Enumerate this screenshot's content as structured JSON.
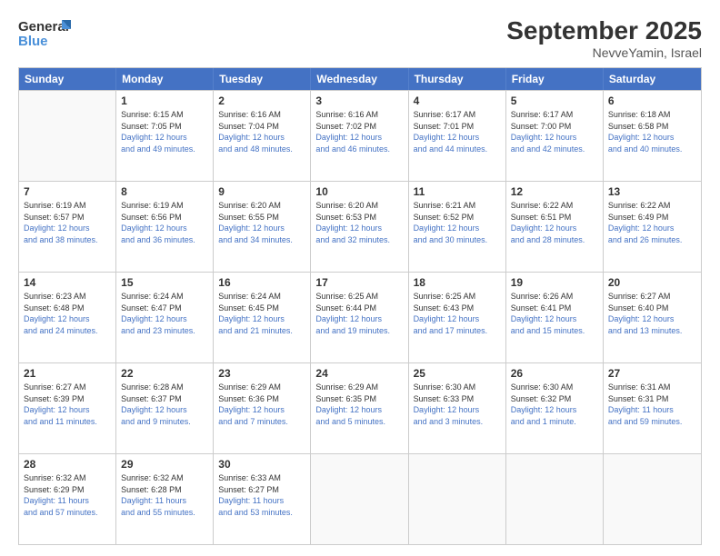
{
  "logo": {
    "line1": "General",
    "line2": "Blue"
  },
  "title": "September 2025",
  "subtitle": "NevveYamin, Israel",
  "headers": [
    "Sunday",
    "Monday",
    "Tuesday",
    "Wednesday",
    "Thursday",
    "Friday",
    "Saturday"
  ],
  "weeks": [
    [
      {
        "day": "",
        "sunrise": "",
        "sunset": "",
        "daylight": ""
      },
      {
        "day": "1",
        "sunrise": "Sunrise: 6:15 AM",
        "sunset": "Sunset: 7:05 PM",
        "daylight": "Daylight: 12 hours and 49 minutes."
      },
      {
        "day": "2",
        "sunrise": "Sunrise: 6:16 AM",
        "sunset": "Sunset: 7:04 PM",
        "daylight": "Daylight: 12 hours and 48 minutes."
      },
      {
        "day": "3",
        "sunrise": "Sunrise: 6:16 AM",
        "sunset": "Sunset: 7:02 PM",
        "daylight": "Daylight: 12 hours and 46 minutes."
      },
      {
        "day": "4",
        "sunrise": "Sunrise: 6:17 AM",
        "sunset": "Sunset: 7:01 PM",
        "daylight": "Daylight: 12 hours and 44 minutes."
      },
      {
        "day": "5",
        "sunrise": "Sunrise: 6:17 AM",
        "sunset": "Sunset: 7:00 PM",
        "daylight": "Daylight: 12 hours and 42 minutes."
      },
      {
        "day": "6",
        "sunrise": "Sunrise: 6:18 AM",
        "sunset": "Sunset: 6:58 PM",
        "daylight": "Daylight: 12 hours and 40 minutes."
      }
    ],
    [
      {
        "day": "7",
        "sunrise": "Sunrise: 6:19 AM",
        "sunset": "Sunset: 6:57 PM",
        "daylight": "Daylight: 12 hours and 38 minutes."
      },
      {
        "day": "8",
        "sunrise": "Sunrise: 6:19 AM",
        "sunset": "Sunset: 6:56 PM",
        "daylight": "Daylight: 12 hours and 36 minutes."
      },
      {
        "day": "9",
        "sunrise": "Sunrise: 6:20 AM",
        "sunset": "Sunset: 6:55 PM",
        "daylight": "Daylight: 12 hours and 34 minutes."
      },
      {
        "day": "10",
        "sunrise": "Sunrise: 6:20 AM",
        "sunset": "Sunset: 6:53 PM",
        "daylight": "Daylight: 12 hours and 32 minutes."
      },
      {
        "day": "11",
        "sunrise": "Sunrise: 6:21 AM",
        "sunset": "Sunset: 6:52 PM",
        "daylight": "Daylight: 12 hours and 30 minutes."
      },
      {
        "day": "12",
        "sunrise": "Sunrise: 6:22 AM",
        "sunset": "Sunset: 6:51 PM",
        "daylight": "Daylight: 12 hours and 28 minutes."
      },
      {
        "day": "13",
        "sunrise": "Sunrise: 6:22 AM",
        "sunset": "Sunset: 6:49 PM",
        "daylight": "Daylight: 12 hours and 26 minutes."
      }
    ],
    [
      {
        "day": "14",
        "sunrise": "Sunrise: 6:23 AM",
        "sunset": "Sunset: 6:48 PM",
        "daylight": "Daylight: 12 hours and 24 minutes."
      },
      {
        "day": "15",
        "sunrise": "Sunrise: 6:24 AM",
        "sunset": "Sunset: 6:47 PM",
        "daylight": "Daylight: 12 hours and 23 minutes."
      },
      {
        "day": "16",
        "sunrise": "Sunrise: 6:24 AM",
        "sunset": "Sunset: 6:45 PM",
        "daylight": "Daylight: 12 hours and 21 minutes."
      },
      {
        "day": "17",
        "sunrise": "Sunrise: 6:25 AM",
        "sunset": "Sunset: 6:44 PM",
        "daylight": "Daylight: 12 hours and 19 minutes."
      },
      {
        "day": "18",
        "sunrise": "Sunrise: 6:25 AM",
        "sunset": "Sunset: 6:43 PM",
        "daylight": "Daylight: 12 hours and 17 minutes."
      },
      {
        "day": "19",
        "sunrise": "Sunrise: 6:26 AM",
        "sunset": "Sunset: 6:41 PM",
        "daylight": "Daylight: 12 hours and 15 minutes."
      },
      {
        "day": "20",
        "sunrise": "Sunrise: 6:27 AM",
        "sunset": "Sunset: 6:40 PM",
        "daylight": "Daylight: 12 hours and 13 minutes."
      }
    ],
    [
      {
        "day": "21",
        "sunrise": "Sunrise: 6:27 AM",
        "sunset": "Sunset: 6:39 PM",
        "daylight": "Daylight: 12 hours and 11 minutes."
      },
      {
        "day": "22",
        "sunrise": "Sunrise: 6:28 AM",
        "sunset": "Sunset: 6:37 PM",
        "daylight": "Daylight: 12 hours and 9 minutes."
      },
      {
        "day": "23",
        "sunrise": "Sunrise: 6:29 AM",
        "sunset": "Sunset: 6:36 PM",
        "daylight": "Daylight: 12 hours and 7 minutes."
      },
      {
        "day": "24",
        "sunrise": "Sunrise: 6:29 AM",
        "sunset": "Sunset: 6:35 PM",
        "daylight": "Daylight: 12 hours and 5 minutes."
      },
      {
        "day": "25",
        "sunrise": "Sunrise: 6:30 AM",
        "sunset": "Sunset: 6:33 PM",
        "daylight": "Daylight: 12 hours and 3 minutes."
      },
      {
        "day": "26",
        "sunrise": "Sunrise: 6:30 AM",
        "sunset": "Sunset: 6:32 PM",
        "daylight": "Daylight: 12 hours and 1 minute."
      },
      {
        "day": "27",
        "sunrise": "Sunrise: 6:31 AM",
        "sunset": "Sunset: 6:31 PM",
        "daylight": "Daylight: 11 hours and 59 minutes."
      }
    ],
    [
      {
        "day": "28",
        "sunrise": "Sunrise: 6:32 AM",
        "sunset": "Sunset: 6:29 PM",
        "daylight": "Daylight: 11 hours and 57 minutes."
      },
      {
        "day": "29",
        "sunrise": "Sunrise: 6:32 AM",
        "sunset": "Sunset: 6:28 PM",
        "daylight": "Daylight: 11 hours and 55 minutes."
      },
      {
        "day": "30",
        "sunrise": "Sunrise: 6:33 AM",
        "sunset": "Sunset: 6:27 PM",
        "daylight": "Daylight: 11 hours and 53 minutes."
      },
      {
        "day": "",
        "sunrise": "",
        "sunset": "",
        "daylight": ""
      },
      {
        "day": "",
        "sunrise": "",
        "sunset": "",
        "daylight": ""
      },
      {
        "day": "",
        "sunrise": "",
        "sunset": "",
        "daylight": ""
      },
      {
        "day": "",
        "sunrise": "",
        "sunset": "",
        "daylight": ""
      }
    ]
  ]
}
